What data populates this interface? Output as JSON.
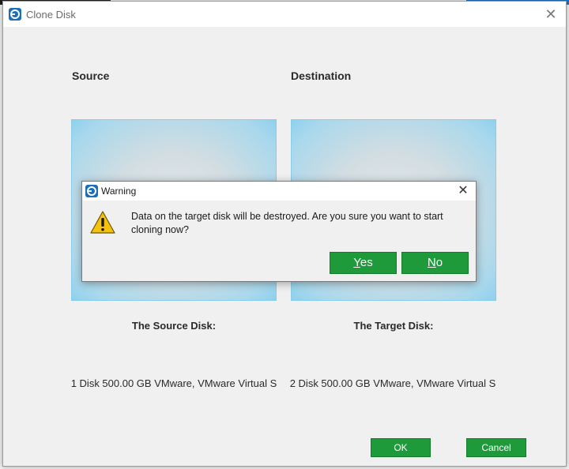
{
  "window": {
    "title": "Clone Disk",
    "close_glyph": "✕"
  },
  "source": {
    "label": "Source",
    "caption": "The Source Disk:",
    "description": "1 Disk 500.00 GB VMware,  VMware Virtual S"
  },
  "destination": {
    "label": "Destination",
    "caption": "The Target Disk:",
    "description": "2 Disk 500.00 GB VMware,  VMware Virtual S"
  },
  "buttons": {
    "ok": "OK",
    "cancel": "Cancel"
  },
  "dialog": {
    "title": "Warning",
    "close_glyph": "✕",
    "message": "Data on the target disk will be destroyed. Are you sure you want to start cloning now?",
    "yes_mnemonic": "Y",
    "yes_rest": "es",
    "no_mnemonic": "N",
    "no_rest": "o"
  },
  "icons": {
    "app": "clone-disk-app-icon",
    "warning": "warning-triangle-icon"
  },
  "colors": {
    "accent_green": "#1f9a3b",
    "panel_blue": "#8bcde9"
  }
}
